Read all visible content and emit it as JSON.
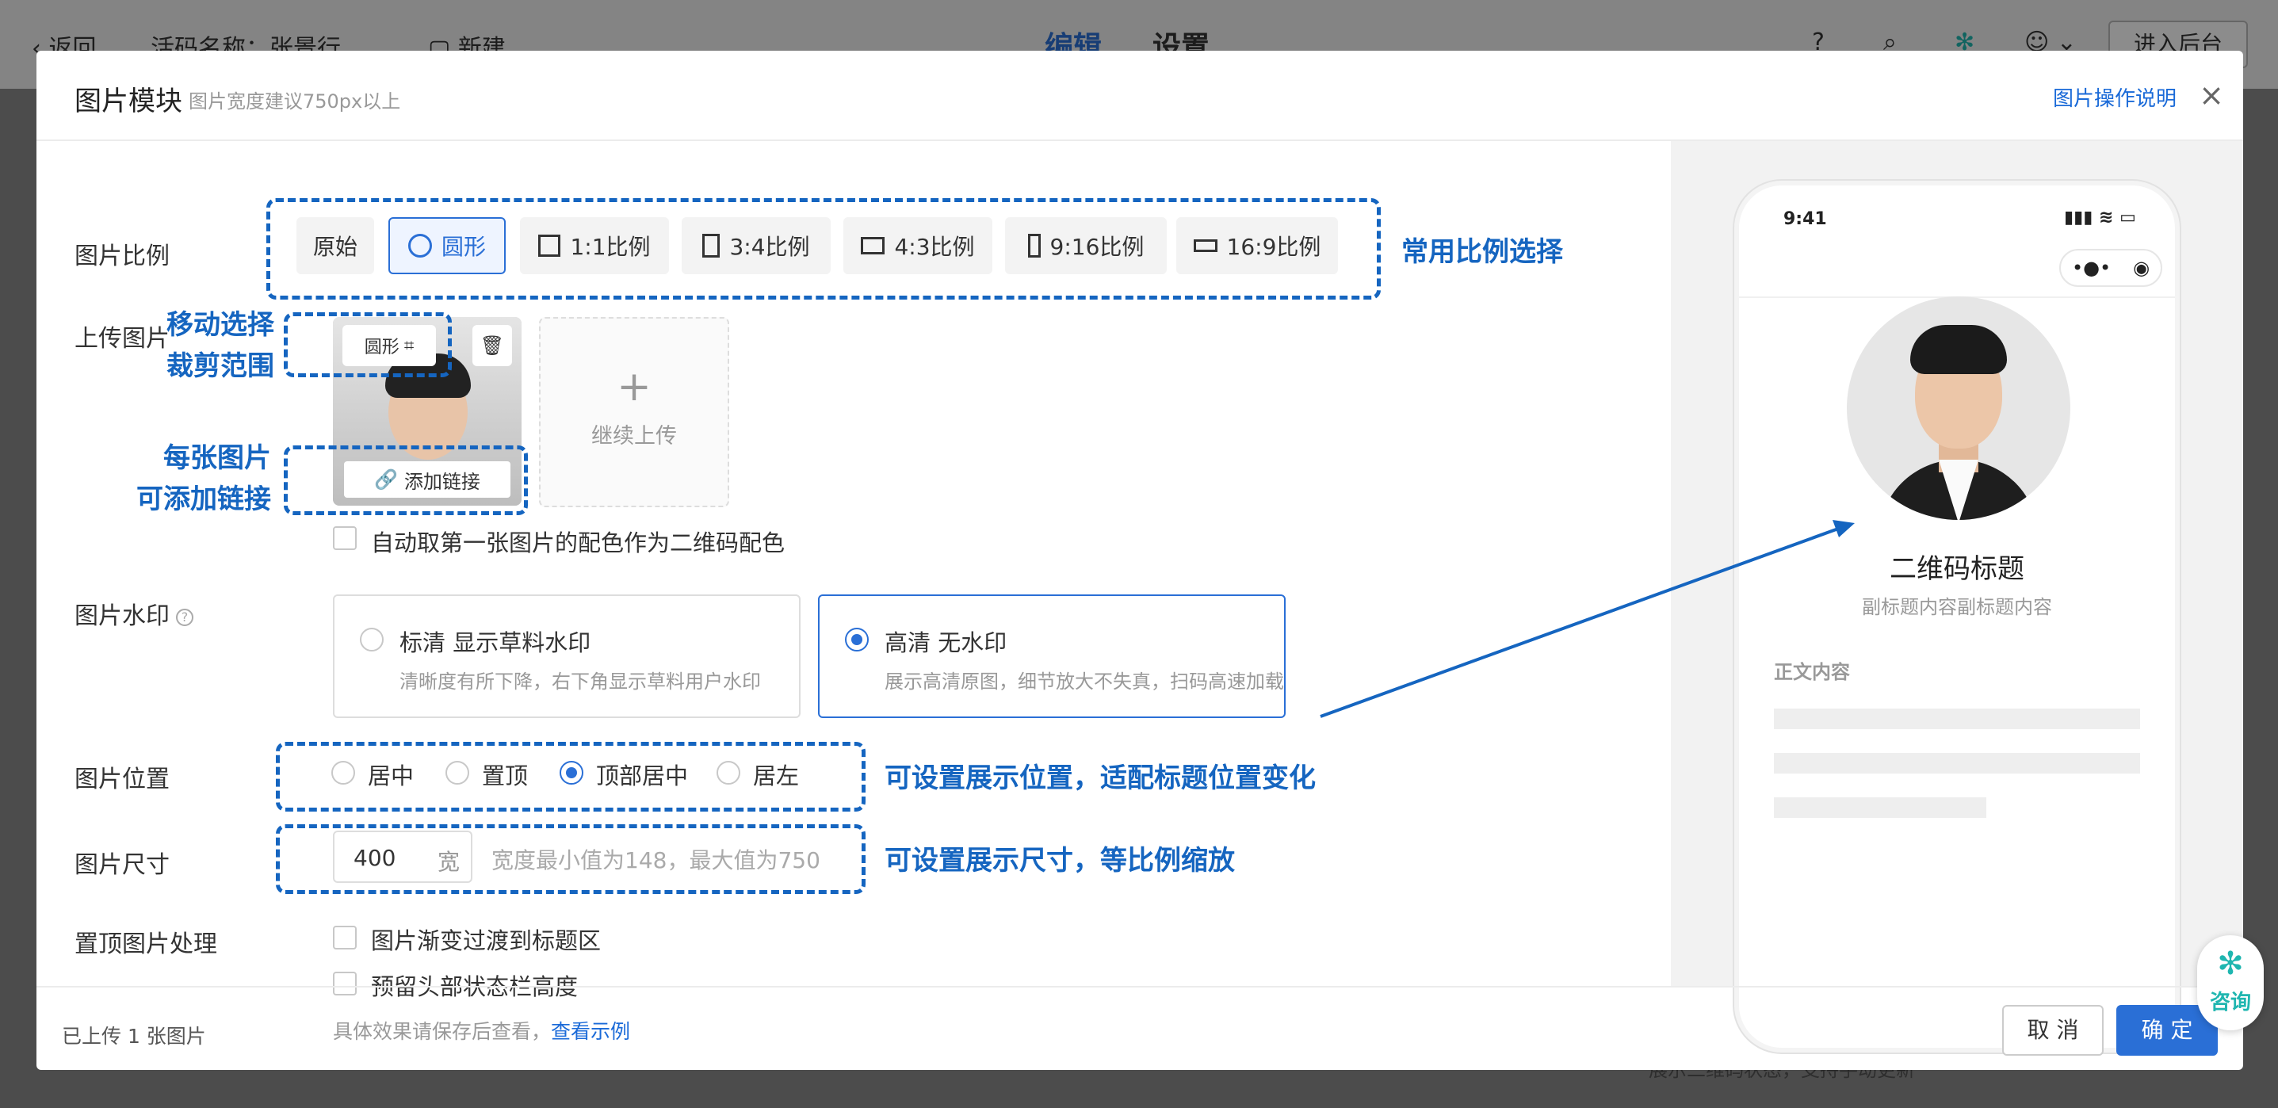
{
  "background": {
    "back": "返回",
    "activity_name": "活码名称：张景行",
    "new": "新建",
    "tab_edit": "编辑",
    "tab_settings": "设置",
    "enter_backend": "进入后台",
    "bottom_text": "展示二维码状态，支持手动更新"
  },
  "modal": {
    "title": "图片模块",
    "subtitle": "图片宽度建议750px以上",
    "help_link": "图片操作说明",
    "ratio": {
      "label": "图片比例",
      "options": [
        "原始",
        "圆形",
        "1:1比例",
        "3:4比例",
        "4:3比例",
        "9:16比例",
        "16:9比例"
      ],
      "selected": "圆形"
    },
    "upload": {
      "label": "上传图片",
      "crop_label": "圆形",
      "add_link": "添加链接",
      "continue": "继续上传",
      "auto_color": "自动取第一张图片的配色作为二维码配色"
    },
    "watermark": {
      "label": "图片水印",
      "options": [
        {
          "title": "标清 显示草料水印",
          "desc": "清晰度有所下降，右下角显示草料用户水印"
        },
        {
          "title": "高清 无水印",
          "desc": "展示高清原图，细节放大不失真，扫码高速加载"
        }
      ],
      "selected": "高清 无水印"
    },
    "position": {
      "label": "图片位置",
      "options": [
        "居中",
        "置顶",
        "顶部居中",
        "居左"
      ],
      "selected": "顶部居中"
    },
    "size": {
      "label": "图片尺寸",
      "value": "400",
      "unit": "宽",
      "hint": "宽度最小值为148，最大值为750"
    },
    "top_processing": {
      "label": "置顶图片处理",
      "options": [
        "图片渐变过渡到标题区",
        "预留头部状态栏高度"
      ],
      "hint": "具体效果请保存后查看，",
      "hint_link": "查看示例"
    },
    "footer": {
      "note": "已上传 1 张图片",
      "cancel": "取 消",
      "ok": "确 定"
    }
  },
  "preview": {
    "time": "9:41",
    "title": "二维码标题",
    "subtitle": "副标题内容副标题内容",
    "body_label": "正文内容"
  },
  "annotations": {
    "ratio": "常用比例选择",
    "crop_line1": "移动选择",
    "crop_line2": "裁剪范围",
    "link_line1": "每张图片",
    "link_line2": "可添加链接",
    "position": "可设置展示位置，适配标题位置变化",
    "size": "可设置展示尺寸，等比例缩放"
  },
  "consult": "咨询",
  "colors": {
    "primary": "#2a6fd6",
    "annotation": "#1565c0"
  }
}
